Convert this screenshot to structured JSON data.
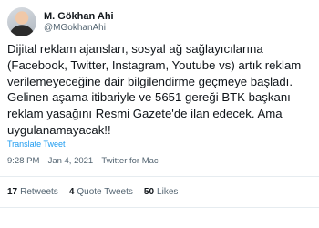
{
  "author": {
    "display_name": "M. Gökhan Ahi",
    "handle": "@MGokhanAhi"
  },
  "tweet": {
    "lines": [
      "Dijital reklam ajansları, sosyal ağ sağlayıcılarına",
      "(Facebook, Twitter, Instagram, Youtube vs) artık reklam",
      "verilemeyeceğine dair bilgilendirme geçmeye başladı.",
      "Gelinen aşama itibariyle ve 5651 gereği BTK başkanı",
      "reklam yasağını Resmi Gazete'de ilan edecek. Ama",
      "uygulanamayacak!!"
    ],
    "translate_label": "Translate Tweet"
  },
  "meta": {
    "time": "9:28 PM",
    "date": "Jan 4, 2021",
    "source": "Twitter for Mac",
    "separator": "·"
  },
  "stats": {
    "retweets_count": "17",
    "retweets_label": "Retweets",
    "quote_count": "4",
    "quote_label": "Quote Tweets",
    "likes_count": "50",
    "likes_label": "Likes"
  }
}
